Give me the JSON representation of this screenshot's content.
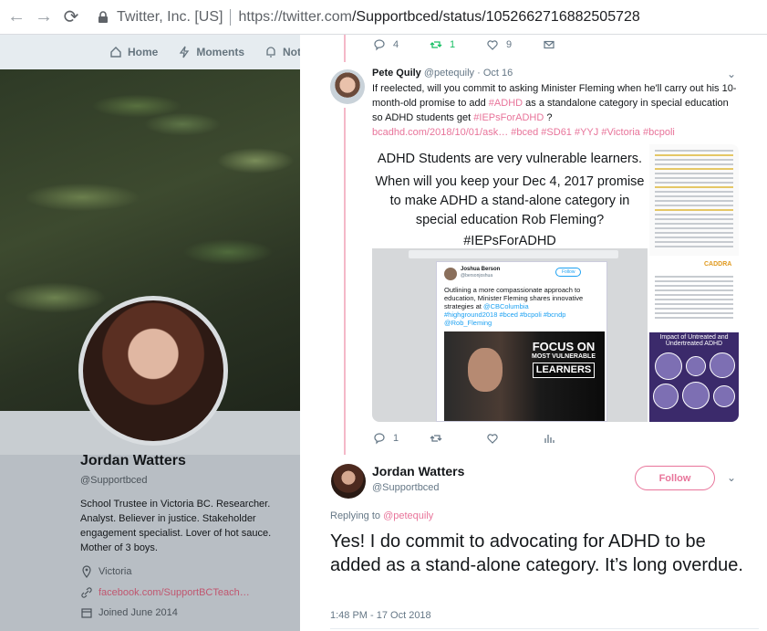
{
  "browser": {
    "site_identity": "Twitter, Inc. [US]",
    "url_host": "https://twitter.com",
    "url_path": "/Supportbced/status/1052662716882505728"
  },
  "topnav": {
    "home": "Home",
    "moments": "Moments",
    "notifications": "Notifi"
  },
  "profile": {
    "name": "Jordan Watters",
    "handle": "@Supportbced",
    "bio": "School Trustee in Victoria BC. Researcher. Analyst. Believer in justice. Stakeholder engagement specialist. Lover of hot sauce. Mother of 3 boys.",
    "location": "Victoria",
    "link": "facebook.com/SupportBCTeach…",
    "joined": "Joined June 2014"
  },
  "prev_actions": {
    "replies": "4",
    "retweets": "1",
    "likes": "9"
  },
  "quoted_tweet": {
    "name": "Pete Quily",
    "handle": "@petequily",
    "date": "· Oct 16",
    "text_1": "If reelected, will you commit to asking Minister Fleming when he'll carry out his 10-month-old promise to add ",
    "tag_adhd": "#ADHD",
    "text_2": " as a standalone category in special education so ADHD students get ",
    "tag_ieps": "#IEPsForADHD",
    "text_3": " ?",
    "links_line": "bcadhd.com/2018/10/01/ask… #bced #SD61 #YYJ #Victoria #bcpoli",
    "media_caption_1": "ADHD Students are very vulnerable learners.",
    "media_caption_2": "When will you keep your Dec 4, 2017 promise to make ADHD a stand-alone category in special education Rob Fleming?",
    "media_caption_3": "#IEPsForADHD",
    "actions": {
      "replies": "1"
    }
  },
  "embedded_screenshot": {
    "name": "Joshua Berson",
    "handle": "@bersonjoshua",
    "follow": "Follow",
    "text": "Outlining a more compassionate approach to education, Minister Fleming shares innovative strategies at ",
    "mention": "@CBColumbia",
    "tags": "#highground2018 #bced #bcpoli #bcndp @Rob_Fleming",
    "photo_line1": "FOCUS ON",
    "photo_line2": "MOST VULNERABLE",
    "photo_line3": "LEARNERS"
  },
  "side_images": {
    "caddra": "CADDRA",
    "impact_title": "Impact of Untreated and Undertreated ADHD"
  },
  "reply": {
    "name": "Jordan Watters",
    "handle": "@Supportbced",
    "follow": "Follow",
    "replying_prefix": "Replying to ",
    "replying_to": "@petequily",
    "text": "Yes! I do commit to advocating for ADHD to be added as a stand-alone category. It’s long overdue.",
    "timestamp": "1:48 PM - 17 Oct 2018"
  },
  "colors": {
    "accent": "#e8749a",
    "retweet": "#17bf63",
    "muted": "#657786"
  }
}
